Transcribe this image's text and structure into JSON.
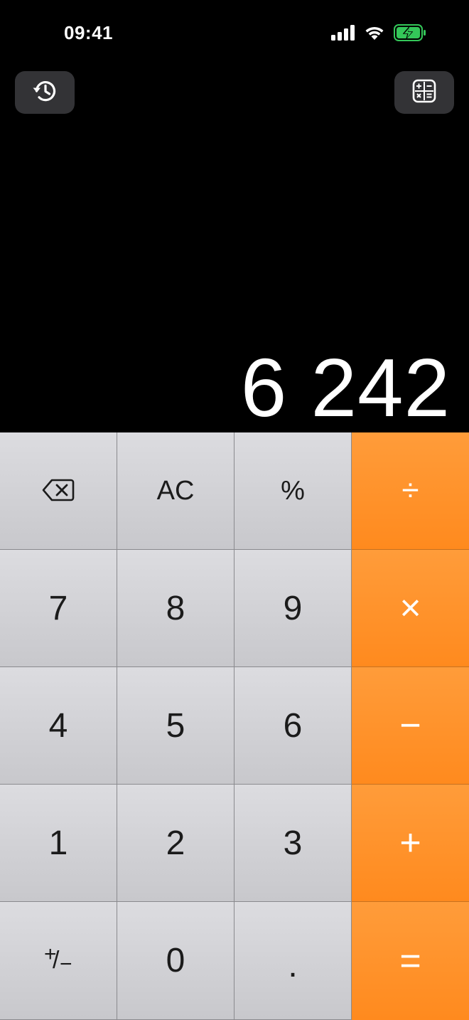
{
  "status": {
    "time": "09:41"
  },
  "top_buttons": {
    "history_icon": "clock-history-icon",
    "mode_icon": "calculator-mode-icon"
  },
  "display": {
    "value": "6 242"
  },
  "keys": {
    "backspace_icon": "backspace-icon",
    "ac": "AC",
    "percent": "%",
    "divide": "÷",
    "seven": "7",
    "eight": "8",
    "nine": "9",
    "multiply": "×",
    "four": "4",
    "five": "5",
    "six": "6",
    "minus": "−",
    "one": "1",
    "two": "2",
    "three": "3",
    "plus": "+",
    "plus_minus_plus": "+",
    "plus_minus_slash": "/",
    "plus_minus_minus": "−",
    "zero": "0",
    "decimal": ".",
    "equals": "="
  },
  "colors": {
    "operator": "#ff9230",
    "key": "#d4d4d8",
    "background": "#000000",
    "battery": "#34c759"
  }
}
